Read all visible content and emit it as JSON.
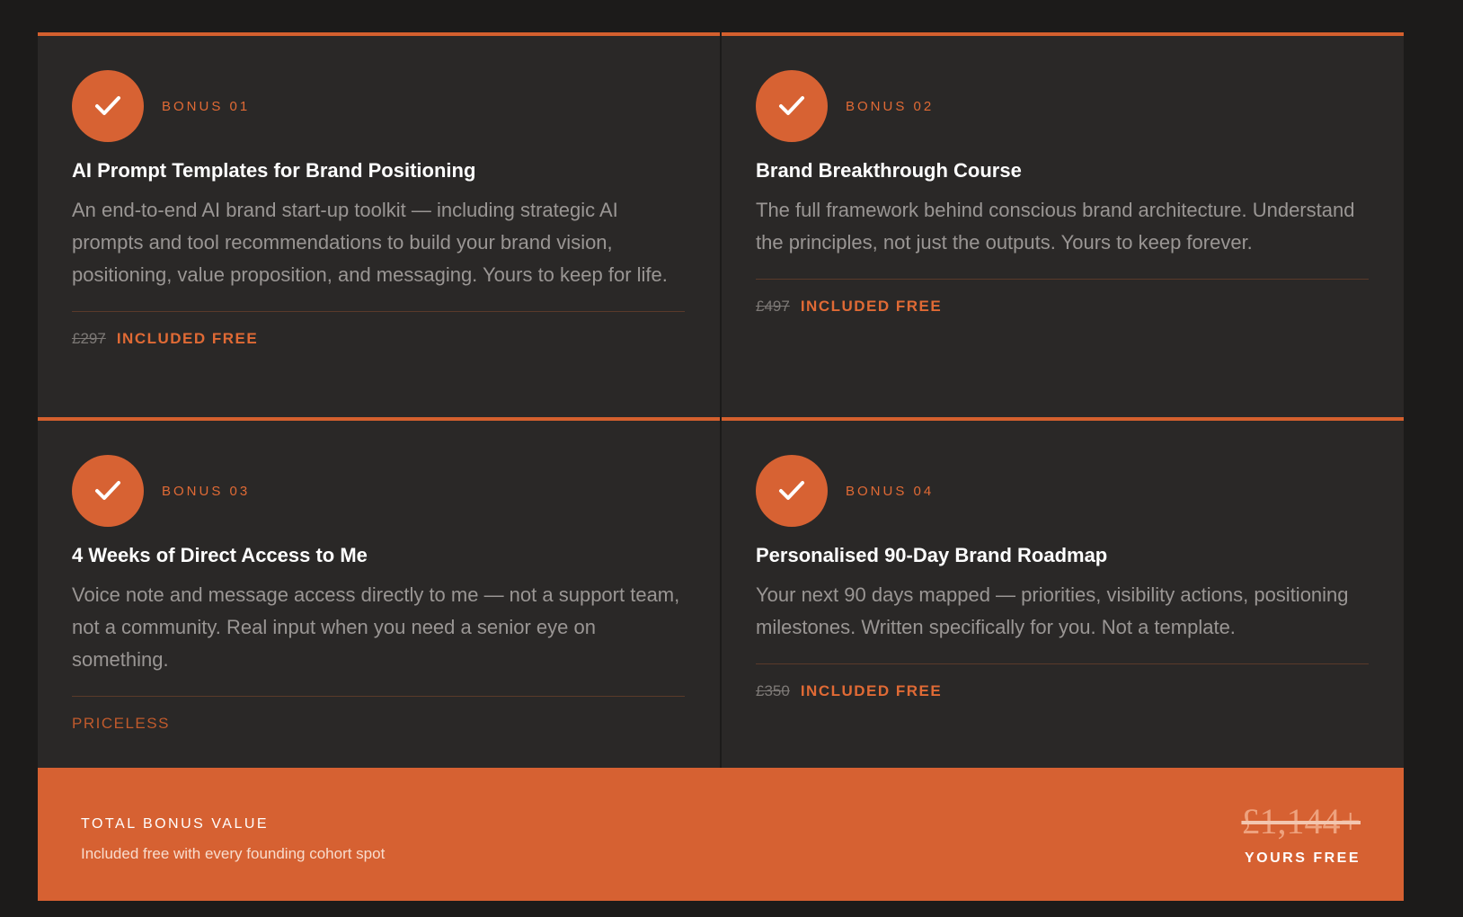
{
  "bonuses": [
    {
      "label": "BONUS 01",
      "title": "AI Prompt Templates for Brand Positioning",
      "description": "An end-to-end AI brand start-up toolkit — including strategic AI prompts and tool recommendations to build your brand vision, positioning, value proposition, and messaging. Yours to keep for life.",
      "old_price": "£297",
      "status": "INCLUDED FREE"
    },
    {
      "label": "BONUS 02",
      "title": "Brand Breakthrough Course",
      "description": "The full framework behind conscious brand architecture. Understand the principles, not just the outputs. Yours to keep forever.",
      "old_price": "£497",
      "status": "INCLUDED FREE"
    },
    {
      "label": "BONUS 03",
      "title": "4 Weeks of Direct Access to Me",
      "description": "Voice note and message access directly to me — not a support team, not a community. Real input when you need a senior eye on something.",
      "status": "PRICELESS"
    },
    {
      "label": "BONUS 04",
      "title": "Personalised 90-Day Brand Roadmap",
      "description": "Your next 90 days mapped — priorities, visibility actions, positioning milestones. Written specifically for you. Not a template.",
      "old_price": "£350",
      "status": "INCLUDED FREE"
    }
  ],
  "total": {
    "label": "TOTAL BONUS VALUE",
    "subtitle": "Included free with every founding cohort spot",
    "price": "£1,144+",
    "free_label": "YOURS FREE"
  },
  "colors": {
    "accent": "#d66132",
    "card_bg": "#2a2827",
    "page_bg": "#1c1b1a"
  },
  "icons": {
    "check": "check-icon"
  }
}
